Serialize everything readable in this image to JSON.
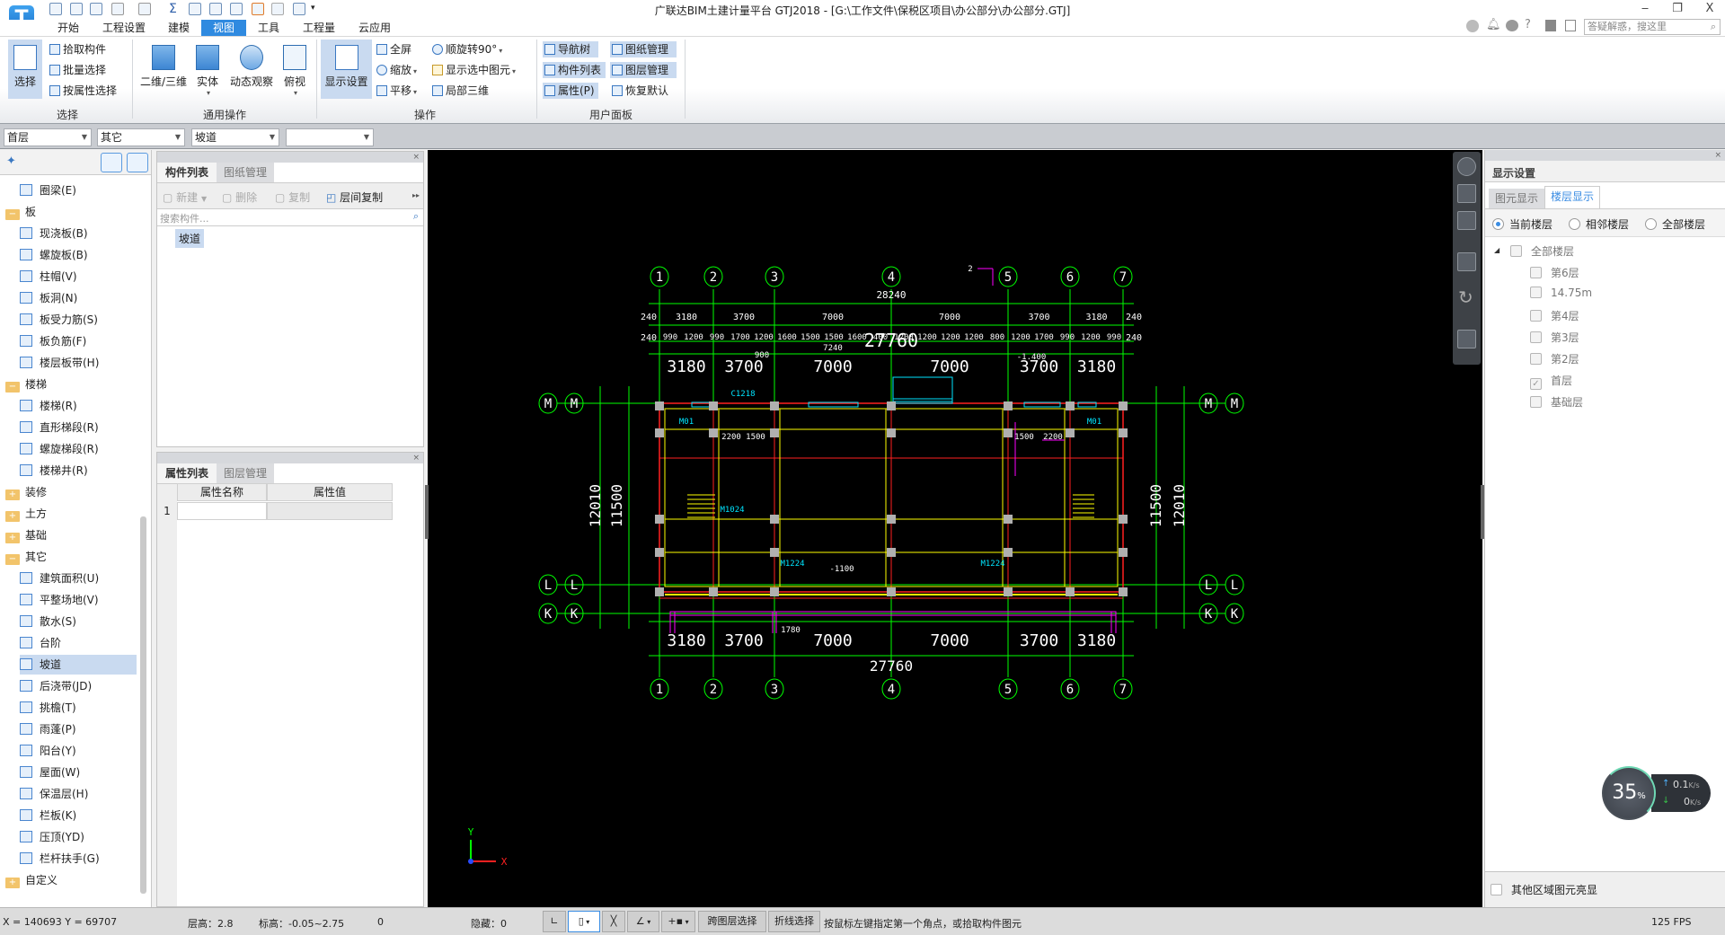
{
  "window": {
    "title": "广联达BIM土建计量平台 GTJ2018 - [G:\\工作文件\\保税区项目\\办公部分\\办公部分.GTJ]",
    "minimize": "‒",
    "restore": "❐",
    "close": "X",
    "logo": "T"
  },
  "tabs": [
    "开始",
    "工程设置",
    "建模",
    "视图",
    "工具",
    "工程量",
    "云应用"
  ],
  "active_tab": "视图",
  "help": {
    "search_placeholder": "答疑解惑，搜这里",
    "icons": [
      "user-icon",
      "bell-icon",
      "chat-icon",
      "help-icon",
      "shirt-icon",
      "upload-icon"
    ]
  },
  "ribbon": {
    "select": {
      "label": "选择",
      "big": "选择",
      "small": [
        "拾取构件",
        "批量选择",
        "按属性选择"
      ]
    },
    "general": {
      "label": "通用操作",
      "buttons": [
        "二维/三维",
        "实体",
        "动态观察",
        "俯视"
      ]
    },
    "ops": {
      "label": "操作",
      "big": "显示设置",
      "col1": [
        "全屏",
        "缩放",
        "平移"
      ],
      "col2": [
        "顺旋转90°",
        "显示选中图元",
        "局部三维"
      ]
    },
    "user": {
      "label": "用户面板",
      "col1": [
        "导航树",
        "构件列表",
        "属性(P)"
      ],
      "col2": [
        "图纸管理",
        "图层管理",
        "恢复默认"
      ]
    }
  },
  "selectors": [
    "首层",
    "其它",
    "坡道",
    ""
  ],
  "tree": {
    "items": [
      {
        "label": "圈梁(E)",
        "type": "child"
      },
      {
        "label": "板",
        "type": "folder-open"
      },
      {
        "label": "现浇板(B)",
        "type": "child"
      },
      {
        "label": "螺旋板(B)",
        "type": "child"
      },
      {
        "label": "柱帽(V)",
        "type": "child"
      },
      {
        "label": "板洞(N)",
        "type": "child"
      },
      {
        "label": "板受力筋(S)",
        "type": "child"
      },
      {
        "label": "板负筋(F)",
        "type": "child"
      },
      {
        "label": "楼层板带(H)",
        "type": "child"
      },
      {
        "label": "楼梯",
        "type": "folder-open"
      },
      {
        "label": "楼梯(R)",
        "type": "child"
      },
      {
        "label": "直形梯段(R)",
        "type": "child"
      },
      {
        "label": "螺旋梯段(R)",
        "type": "child"
      },
      {
        "label": "楼梯井(R)",
        "type": "child"
      },
      {
        "label": "装修",
        "type": "folder-closed"
      },
      {
        "label": "土方",
        "type": "folder-closed"
      },
      {
        "label": "基础",
        "type": "folder-closed"
      },
      {
        "label": "其它",
        "type": "folder-open"
      },
      {
        "label": "建筑面积(U)",
        "type": "child"
      },
      {
        "label": "平整场地(V)",
        "type": "child"
      },
      {
        "label": "散水(S)",
        "type": "child"
      },
      {
        "label": "台阶",
        "type": "child"
      },
      {
        "label": "坡道",
        "type": "child",
        "selected": true
      },
      {
        "label": "后浇带(JD)",
        "type": "child"
      },
      {
        "label": "挑檐(T)",
        "type": "child"
      },
      {
        "label": "雨蓬(P)",
        "type": "child"
      },
      {
        "label": "阳台(Y)",
        "type": "child"
      },
      {
        "label": "屋面(W)",
        "type": "child"
      },
      {
        "label": "保温层(H)",
        "type": "child"
      },
      {
        "label": "栏板(K)",
        "type": "child"
      },
      {
        "label": "压顶(YD)",
        "type": "child"
      },
      {
        "label": "栏杆扶手(G)",
        "type": "child"
      },
      {
        "label": "自定义",
        "type": "folder-closed"
      }
    ]
  },
  "component_panel": {
    "tabs": [
      "构件列表",
      "图纸管理"
    ],
    "toolbar": {
      "new": "新建",
      "delete": "删除",
      "copy": "复制",
      "floor_copy": "层间复制"
    },
    "search_placeholder": "搜索构件...",
    "items": [
      "坡道"
    ],
    "close": "×"
  },
  "property_panel": {
    "tabs": [
      "属性列表",
      "图层管理"
    ],
    "columns": [
      "属性名称",
      "属性值"
    ],
    "rows": [
      "1"
    ],
    "close": "×"
  },
  "display_panel": {
    "title": "显示设置",
    "close": "×",
    "tabs": [
      "图元显示",
      "楼层显示"
    ],
    "active_tab": "楼层显示",
    "radios": [
      {
        "label": "当前楼层",
        "checked": true
      },
      {
        "label": "相邻楼层",
        "checked": false
      },
      {
        "label": "全部楼层",
        "checked": false
      }
    ],
    "root": "全部楼层",
    "floors": [
      {
        "label": "第6层",
        "checked": false
      },
      {
        "label": "14.75m",
        "checked": false
      },
      {
        "label": "第4层",
        "checked": false
      },
      {
        "label": "第3层",
        "checked": false
      },
      {
        "label": "第2层",
        "checked": false
      },
      {
        "label": "首层",
        "checked": true
      },
      {
        "label": "基础层",
        "checked": false
      }
    ],
    "highlight_other": "其他区域图元亮显"
  },
  "network_widget": {
    "percent": "35",
    "percent_unit": "%",
    "up": "0.1",
    "down": "0",
    "rate_unit": "K/s"
  },
  "cad": {
    "col_axes": [
      "1",
      "2",
      "3",
      "4",
      "5",
      "6",
      "7"
    ],
    "row_axes": [
      "M",
      "L",
      "K"
    ],
    "overall_top": "28240",
    "overall_mid": "27760",
    "overall_bottom": "27760",
    "bay_small": [
      "3180",
      "3700",
      "7000",
      "7000",
      "3700",
      "3180"
    ],
    "edge": "240",
    "detail": [
      "990",
      "1200",
      "990",
      "1700",
      "1200",
      "1600",
      "1500",
      "1500",
      "1600",
      "400",
      "1200",
      "1200",
      "1200",
      "1200",
      "800",
      "1200",
      "1700",
      "990",
      "1200",
      "990"
    ],
    "bay_large": [
      "3180",
      "3700",
      "7000",
      "7000",
      "3700",
      "3180"
    ],
    "bay_bottom": [
      "3180",
      "3700",
      "7000",
      "7000",
      "3700",
      "3180"
    ],
    "depth_outer": "12010",
    "depth_inner": "11500",
    "notes": [
      "7240",
      "900",
      "-1.400",
      "1780",
      "C1218",
      "M1224",
      "M1224",
      "M1024",
      "M01",
      "M01",
      "-1100",
      "2200",
      "1500",
      "1500",
      "2200",
      "2"
    ],
    "colors": {
      "axis": "#00ff00",
      "wall": "#ff2020",
      "beam": "#ffff00",
      "ramp": "#ff00ff",
      "window": "#00e5ff",
      "column": "#b0b0b0",
      "text": "#ffffff"
    },
    "axis_indicator": {
      "x": "X",
      "y": "Y"
    }
  },
  "status": {
    "coords": "X = 140693 Y = 69707",
    "floor_height": "层高：2.8",
    "elevation": "标高：-0.05~2.75",
    "count": "0",
    "hidden": "隐藏：0",
    "cross_layer": "跨图层选择",
    "polyline": "折线选择",
    "hint": "按鼠标左键指定第一个角点，或拾取构件图元",
    "fps": "125 FPS"
  }
}
